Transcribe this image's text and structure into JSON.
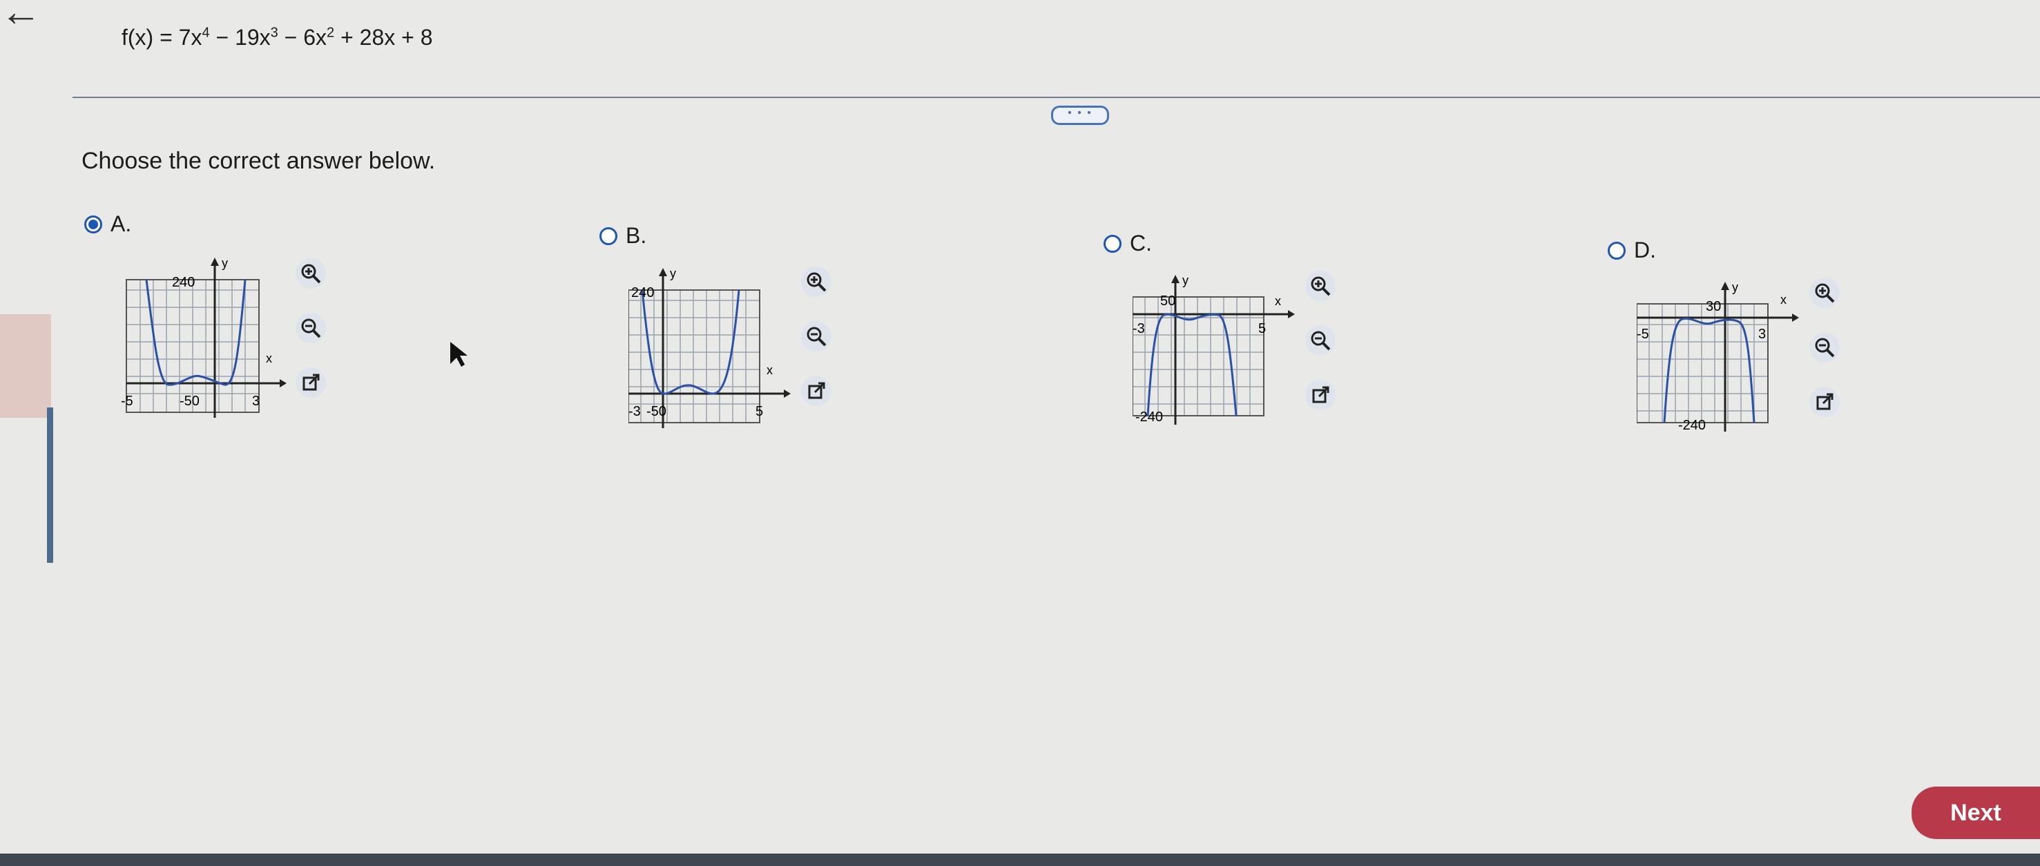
{
  "nav": {
    "back_icon": "back-arrow-icon"
  },
  "question": {
    "function_lhs": "f(x) = 7x",
    "exp4": "4",
    "term2": " − 19x",
    "exp3": "3",
    "term3": " − 6x",
    "exp2": "2",
    "term4": " + 28x + 8",
    "expand_label": "• • •",
    "prompt": "Choose the correct answer below."
  },
  "options": [
    {
      "letter": "A.",
      "selected": true,
      "labels": {
        "ytop": "240",
        "ybot": "-50",
        "xleft": "-5",
        "xright": "3",
        "xaxis": "x",
        "yaxis": "y"
      }
    },
    {
      "letter": "B.",
      "selected": false,
      "labels": {
        "ytop": "240",
        "ybot": "-50",
        "xleft": "-3",
        "xright": "5",
        "xaxis": "x",
        "yaxis": "y"
      }
    },
    {
      "letter": "C.",
      "selected": false,
      "labels": {
        "ytop": "50",
        "ybot": "-240",
        "xleft": "-3",
        "xright": "5",
        "xaxis": "x",
        "yaxis": "y"
      }
    },
    {
      "letter": "D.",
      "selected": false,
      "labels": {
        "ytop": "30",
        "ybot": "-240",
        "xleft": "-5",
        "xright": "3",
        "xaxis": "x",
        "yaxis": "y"
      }
    }
  ],
  "tool_icons": [
    "zoom-in-icon",
    "zoom-out-icon",
    "open-new-window-icon"
  ],
  "colors": {
    "accent": "#1f56b4",
    "curve": "#2b50a6",
    "next": "#b8394a"
  },
  "next_label": "Next"
}
